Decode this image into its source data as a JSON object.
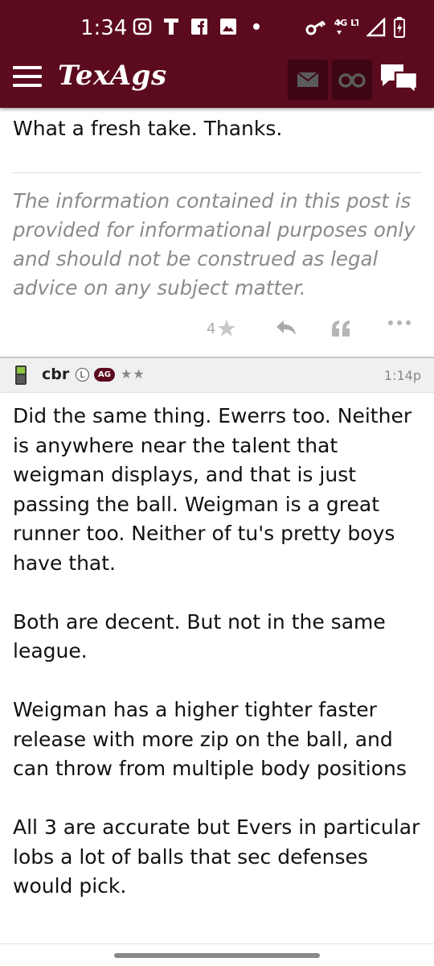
{
  "status_bar": {
    "time": "1:34",
    "left_icons": [
      "screen-record-icon",
      "t-mobile-icon",
      "facebook-icon",
      "image-icon",
      "dot-icon"
    ],
    "network": "4G LTE",
    "right_icons": [
      "vpn-key-icon",
      "network-4g-icon",
      "signal-icon",
      "battery-charging-icon"
    ]
  },
  "header": {
    "logo": "TexAgs",
    "icons": [
      "menu-icon",
      "mail-icon",
      "binoculars-icon",
      "chat-icon"
    ],
    "color": "#5c0a1e"
  },
  "previous_post": {
    "text": "What a fresh take. Thanks.",
    "signature": "The information contained in this post is provided for informational purposes only and should not be construed as legal advice on any subject matter.",
    "stars_count": "4"
  },
  "post": {
    "username": "cbr",
    "badge_l": "L",
    "badge_ag": "AG",
    "stars": "★★",
    "time": "1:14p",
    "paragraphs": [
      "Did the same thing. Ewerrs too. Neither is anywhere near the talent that weigman displays, and that is just passing the ball. Weigman is a great runner too. Neither of tu's pretty boys have that.",
      "Both are decent. But not in the same league.",
      "Weigman has a higher tighter faster release with more zip on the ball, and can throw from multiple body positions",
      "All 3 are accurate but Evers in particular lobs a lot of balls that sec defenses would pick."
    ]
  }
}
